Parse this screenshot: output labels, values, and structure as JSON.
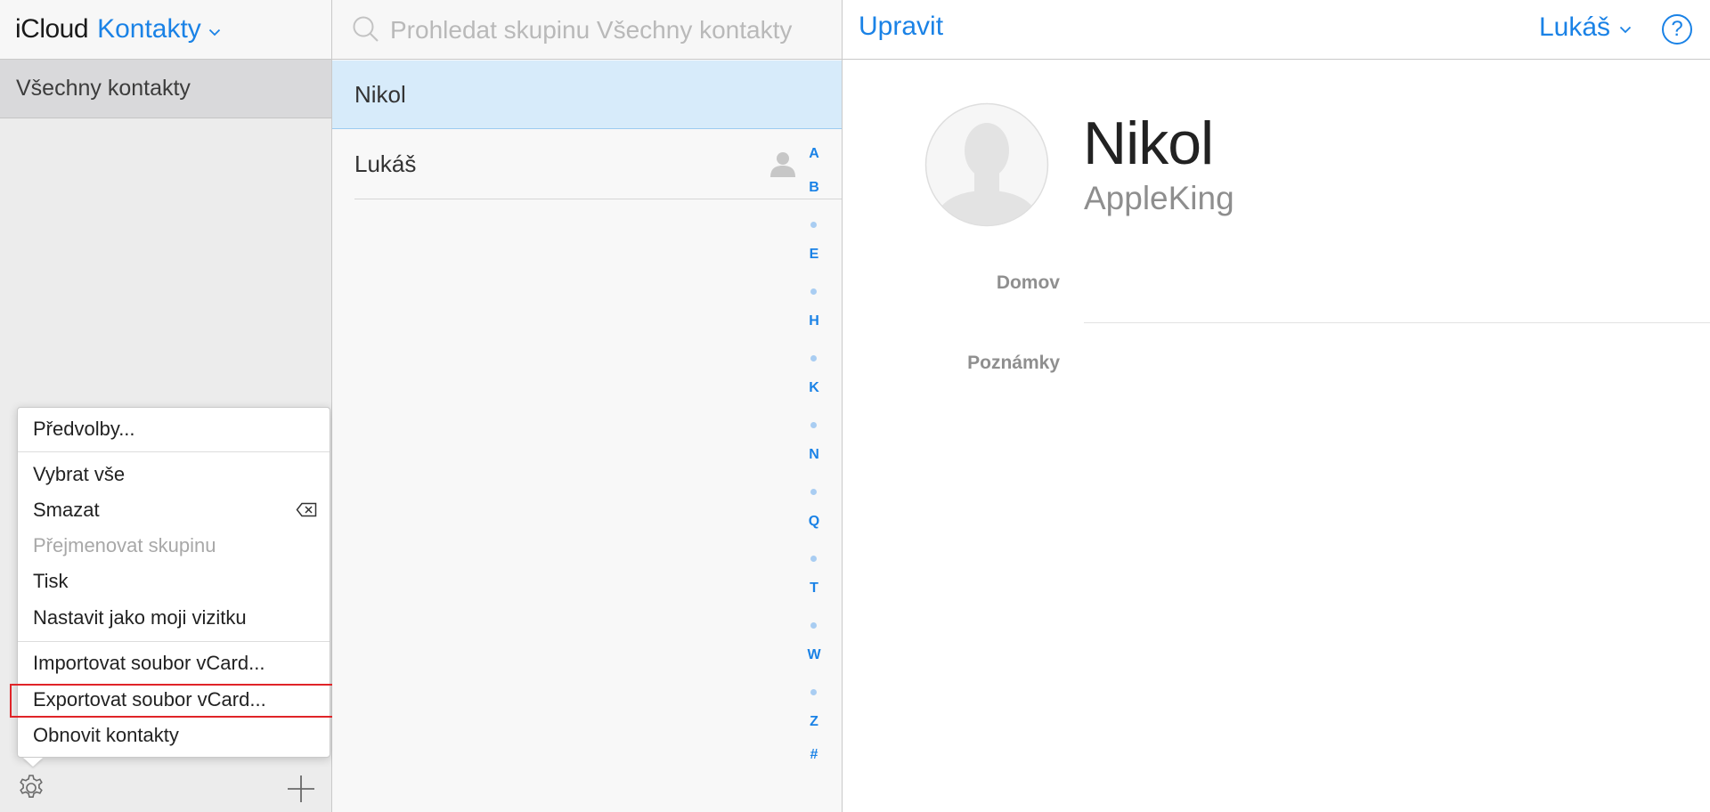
{
  "sidebar": {
    "brand": "iCloud",
    "app_name": "Kontakty",
    "groups": [
      {
        "label": "Všechny kontakty"
      }
    ]
  },
  "menu": {
    "items": [
      {
        "label": "Předvolby...",
        "enabled": true
      },
      {
        "label": "Vybrat vše",
        "enabled": true
      },
      {
        "label": "Smazat",
        "enabled": true
      },
      {
        "label": "Přejmenovat skupinu",
        "enabled": false
      },
      {
        "label": "Tisk",
        "enabled": true
      },
      {
        "label": "Nastavit jako moji vizitku",
        "enabled": true
      },
      {
        "label": "Importovat soubor vCard...",
        "enabled": true
      },
      {
        "label": "Exportovat soubor vCard...",
        "enabled": true,
        "highlighted": true
      },
      {
        "label": "Obnovit kontakty",
        "enabled": true
      }
    ]
  },
  "search": {
    "placeholder": "Prohledat skupinu Všechny kontakty",
    "value": ""
  },
  "contacts": [
    {
      "name": "Nikol",
      "selected": true
    },
    {
      "name": "Lukáš",
      "is_me": true
    }
  ],
  "alpha_index": [
    "A",
    "B",
    "•",
    "E",
    "•",
    "H",
    "•",
    "K",
    "•",
    "N",
    "•",
    "Q",
    "•",
    "T",
    "•",
    "W",
    "•",
    "Z",
    "#"
  ],
  "header": {
    "edit_label": "Upravit",
    "user_name": "Lukáš",
    "help_label": "?"
  },
  "detail": {
    "name": "Nikol",
    "company": "AppleKing",
    "fields": [
      {
        "label": "Domov"
      },
      {
        "label": "Poznámky"
      }
    ]
  },
  "colors": {
    "accent": "#1a82e6",
    "selection": "#d7ebfa",
    "highlight_box": "#e02428"
  }
}
